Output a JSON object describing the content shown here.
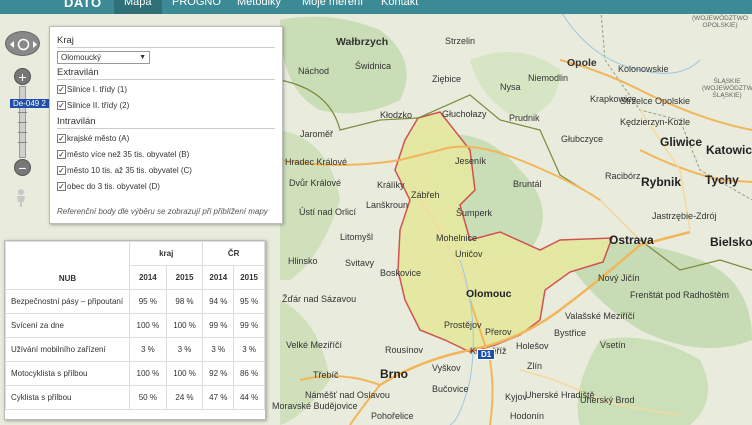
{
  "nav": {
    "brand": "DATO",
    "items": [
      {
        "label": "Mapa",
        "active": true
      },
      {
        "label": "PROGNÓ",
        "active": false
      },
      {
        "label": "Metodiky",
        "active": false
      },
      {
        "label": "Moje měření",
        "active": false
      },
      {
        "label": "Kontakt",
        "active": false
      }
    ]
  },
  "map": {
    "zoom_label": "De-049 2",
    "cities_major": [
      "Wałbrzych",
      "Opole",
      "Olomouc",
      "Ostrava",
      "Brno",
      "Gliwice",
      "Katowice",
      "Tychy",
      "Rybnik",
      "Bielsko-B"
    ],
    "places": [
      "Strzelin",
      "Świdnica",
      "Kolonowskie",
      "Niemodlin",
      "Ziębice",
      "Krapkowice",
      "Głuchołazy",
      "Nysa",
      "Kłodzko",
      "Strzelce Opolskie",
      "Prudnik",
      "Kędzierzyn-Koźle",
      "Głubczyce",
      "Racibórz",
      "Hradec Králové",
      "Jeseník",
      "Jastrzębie-Zdrój",
      "Šumperk",
      "Bruntál",
      "Ústí nad Orlicí",
      "Litomyšl",
      "Hlinsko",
      "Svitavy",
      "Mohelnice",
      "Uničov",
      "Nový Jičín",
      "Frenštát pod Radhoštěm",
      "Valašské Meziříčí",
      "Žďár nad Sázavou",
      "Prostějov",
      "Přerov",
      "Holešov",
      "Vsetín",
      "Kroměříž",
      "Zlín",
      "Bystřice",
      "Velké Meziříčí",
      "Vyškov",
      "Uherské Hradiště",
      "Uherský Brod",
      "Třebíč",
      "Hodonín",
      "Moravské Budějovice",
      "Pohořelice",
      "Bučovice",
      "Náchod",
      "Jaroměř",
      "Králíky",
      "Lanškroun",
      "Zábřeh",
      "Dvůr Králové",
      "Náměšť nad Oslavou",
      "Rousínov",
      "Kyjov",
      "Boskovice"
    ],
    "region_labels": [
      "(WOJEWÓDZTWO OPOLSKIE)",
      "ŚLĄSKIE (WOJEWÓDZTWO ŚLĄSKIE)"
    ],
    "road_label": "D1"
  },
  "layer_panel": {
    "kraj_title": "Kraj",
    "kraj_selected": "Olomoucký",
    "extravilan_title": "Extravilán",
    "extravilan_items": [
      "Silnice I. třídy (1)",
      "Silnice II. třídy (2)"
    ],
    "intravilan_title": "Intravilán",
    "intravilan_items": [
      "krajské město (A)",
      "město více než 35 tis. obyvatel (B)",
      "město 10 tis. až 35 tis. obyvatel (C)",
      "obec do 3 tis. obyvatel (D)"
    ],
    "note": "Referenční body dle výběru se zobrazují při přiblížení mapy"
  },
  "table": {
    "group_kraj": "kraj",
    "group_cr": "ČR",
    "row_header": "NUB",
    "years": [
      "2014",
      "2015",
      "2014",
      "2015"
    ],
    "rows": [
      {
        "label": "Bezpečnostní pásy – připoutaní",
        "values": [
          "95 %",
          "98 %",
          "94 %",
          "95 %"
        ]
      },
      {
        "label": "Svícení za dne",
        "values": [
          "100 %",
          "100 %",
          "99 %",
          "99 %"
        ]
      },
      {
        "label": "Užívání mobilního zařízení",
        "values": [
          "3 %",
          "3 %",
          "3 %",
          "3 %"
        ]
      },
      {
        "label": "Motocyklista s přilbou",
        "values": [
          "100 %",
          "100 %",
          "92 %",
          "86 %"
        ]
      },
      {
        "label": "Cyklista s přilbou",
        "values": [
          "50 %",
          "24 %",
          "47 %",
          "44 %"
        ]
      }
    ]
  },
  "colors": {
    "nav_bg": "#3c8a95",
    "region_fill": "#e4e8a0",
    "region_border": "#d04a4a",
    "forest": "#c7dcb4",
    "road": "#f2b65a",
    "motorway_shield": "#1f4fa8"
  }
}
